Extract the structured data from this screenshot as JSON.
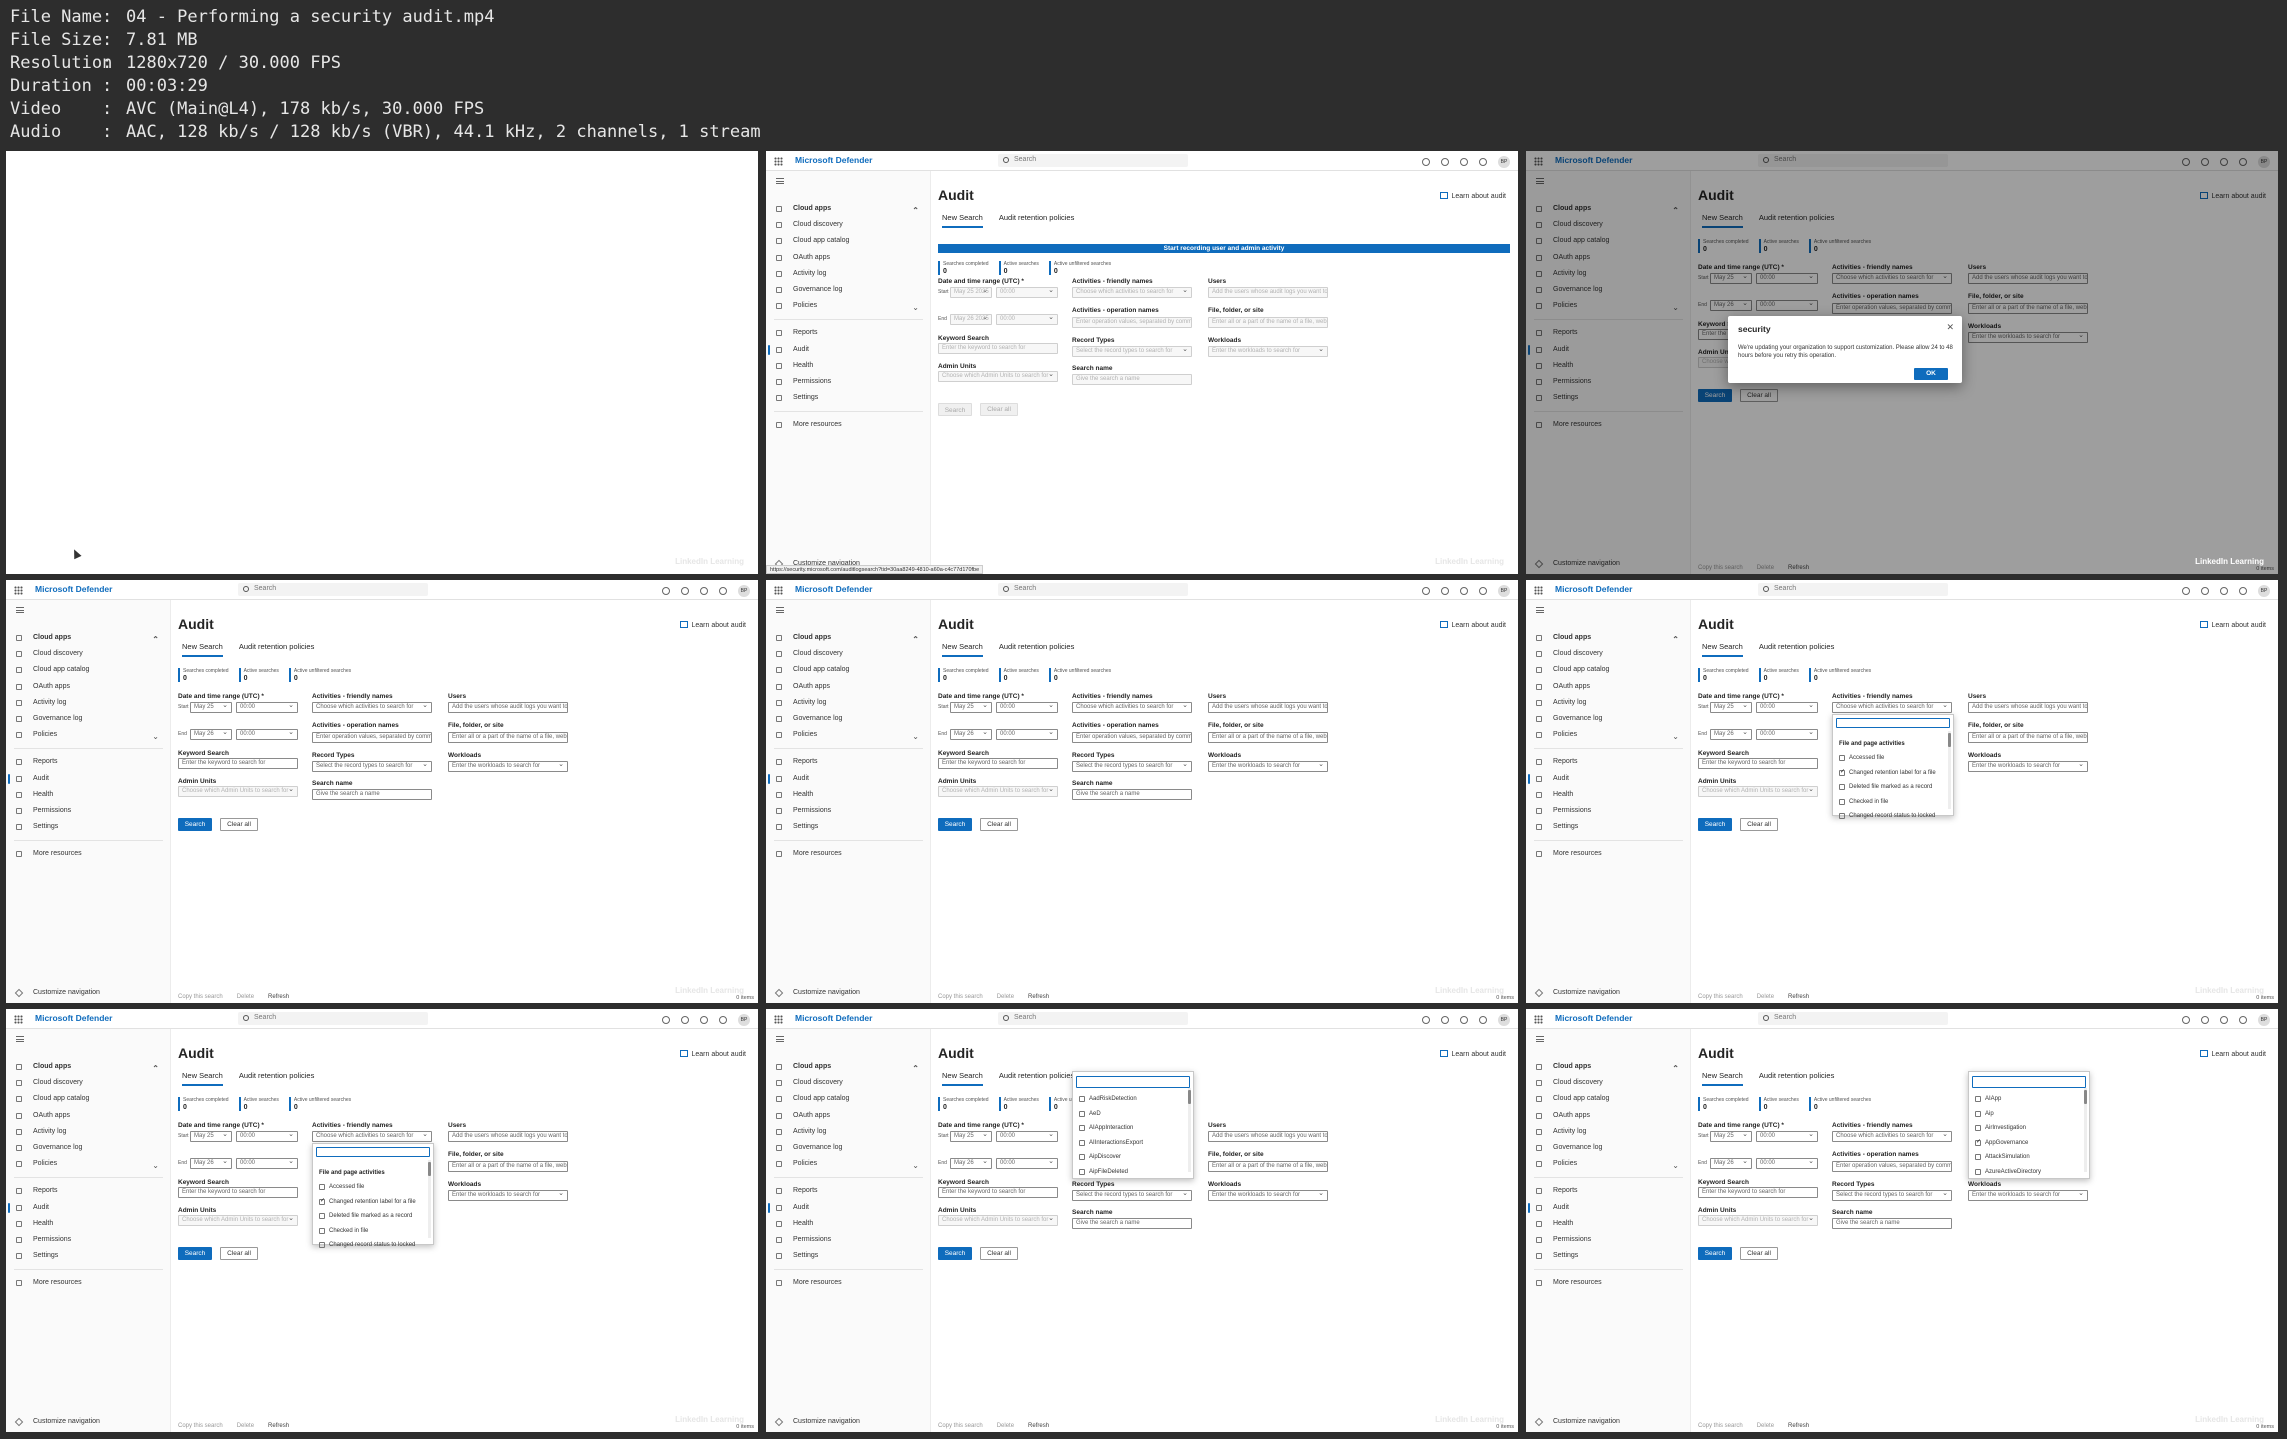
{
  "info": {
    "rows": [
      {
        "key": "File Name",
        "value": "04 - Performing a security audit.mp4"
      },
      {
        "key": "File Size",
        "value": "7.81 MB"
      },
      {
        "key": "Resolution",
        "value": "1280x720 / 30.000 FPS"
      },
      {
        "key": "Duration",
        "value": "00:03:29"
      },
      {
        "key": "Video",
        "value": "AVC (Main@L4), 178 kb/s, 30.000 FPS"
      },
      {
        "key": "Audio",
        "value": "AAC, 128 kb/s / 128 kb/s (VBR), 44.1 kHz, 2 channels, 1 stream"
      }
    ]
  },
  "app": {
    "brand": "Microsoft Defender",
    "search_placeholder": "Search",
    "avatar": "BP",
    "nav": {
      "cloud_apps": "Cloud apps",
      "cloud_discovery": "Cloud discovery",
      "cloud_app_catalog": "Cloud app catalog",
      "oauth_apps": "OAuth apps",
      "activity_log": "Activity log",
      "governance_log": "Governance log",
      "policies": "Policies",
      "reports": "Reports",
      "audit": "Audit",
      "health": "Health",
      "permissions": "Permissions",
      "settings": "Settings",
      "more_resources": "More resources",
      "customize_navigation": "Customize navigation"
    },
    "page_title": "Audit",
    "learn": "Learn about audit",
    "tabs": {
      "new_search": "New Search",
      "retention": "Audit retention policies"
    },
    "banner": "Start recording user and admin activity",
    "stats": {
      "completed_label": "Searches completed",
      "active_label": "Active searches",
      "unfiltered_label": "Active unfiltered searches",
      "completed": "0",
      "active": "0",
      "unfiltered": "0"
    },
    "form": {
      "date_label": "Date and time range (UTC) *",
      "start": "Start",
      "end": "End",
      "start_date": "May 25",
      "end_date": "May 26",
      "start_date_long": "May 25 2025",
      "end_date_long": "May 26 2025",
      "time": "00:00",
      "keyword_label": "Keyword Search",
      "keyword_ph": "Enter the keyword to search for",
      "admin_units_label": "Admin Units",
      "admin_units_ph": "Choose which Admin Units to search for",
      "friendly_label": "Activities - friendly names",
      "friendly_ph": "Choose which activities to search for",
      "opnames_label": "Activities - operation names",
      "opnames_ph": "Enter operation values, separated by commas",
      "record_types_label": "Record Types",
      "record_types_ph": "Select the record types to search for",
      "search_name_label": "Search name",
      "search_name_ph": "Give the search a name",
      "users_label": "Users",
      "users_ph": "Add the users whose audit logs you want to ...",
      "file_label": "File, folder, or site",
      "file_ph": "Enter all or a part of the name of a file, web...",
      "workloads_label": "Workloads",
      "workloads_ph": "Enter the workloads to search for",
      "search_btn": "Search",
      "clear_btn": "Clear all"
    },
    "cmd": {
      "copy": "Copy this search",
      "delete": "Delete",
      "refresh": "Refresh",
      "items": "0 items"
    },
    "activities_dropdown": {
      "group": "File and page activities",
      "options": [
        "Accessed file",
        "Changed retention label for a file",
        "Deleted file marked as a record",
        "Checked in file",
        "Changed record status to locked"
      ]
    },
    "record_types_dropdown": {
      "options": [
        "AadRiskDetection",
        "AeD",
        "AIAppInteraction",
        "AIInteractionsExport",
        "AipDiscover",
        "AipFileDeleted"
      ]
    },
    "workloads_dropdown": {
      "options": [
        "AIApp",
        "Aip",
        "AirInvestigation",
        "AppGovernance",
        "AttackSimulation",
        "AzureActiveDirectory"
      ]
    },
    "dialog": {
      "title": "security",
      "message": "We're updating your organization to support customization. Please allow 24 to 48 hours before you retry this operation.",
      "ok": "OK"
    },
    "status_url": "https://security.microsoft.com/auditlogsearch?tid=30aa8249-4810-a60a-c4c77d170fbe",
    "watermark": "LinkedIn Learning"
  }
}
